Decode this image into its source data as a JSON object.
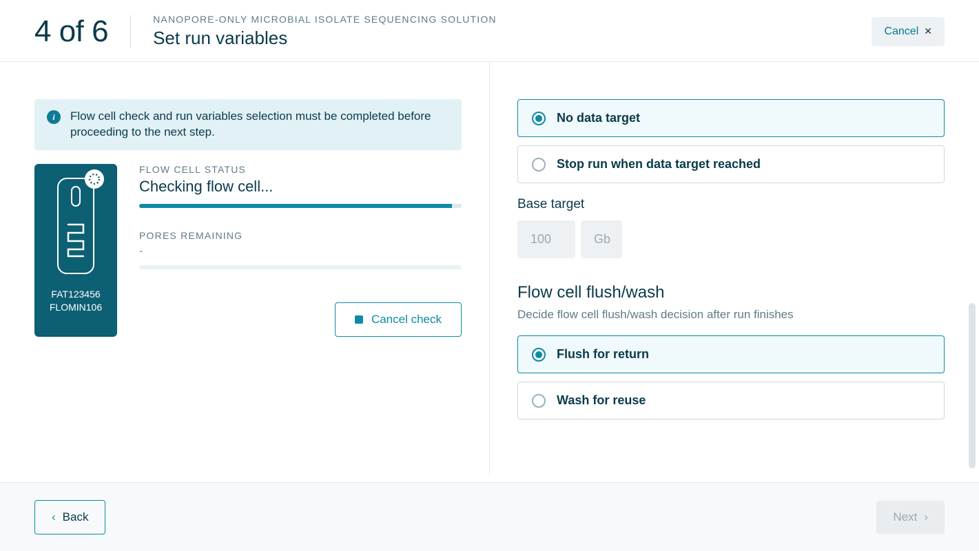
{
  "header": {
    "step_counter": "4 of 6",
    "subtitle": "NANOPORE-ONLY MICROBIAL ISOLATE SEQUENCING SOLUTION",
    "title": "Set run variables",
    "cancel_label": "Cancel"
  },
  "left": {
    "info_text": "Flow cell check and run variables selection must be completed before proceeding to the next step.",
    "flow_card": {
      "line1": "FAT123456",
      "line2": "FLOMIN106"
    },
    "status_label": "FLOW CELL STATUS",
    "status_value": "Checking flow cell...",
    "status_progress_pct": 97,
    "pores_label": "PORES REMAINING",
    "pores_value": "-",
    "cancel_check_label": "Cancel check"
  },
  "right": {
    "data_target": {
      "options": [
        {
          "label": "No data target",
          "selected": true
        },
        {
          "label": "Stop run when data target reached",
          "selected": false
        }
      ],
      "base_target_label": "Base target",
      "base_target_value": "100",
      "base_target_unit": "Gb"
    },
    "flush": {
      "title": "Flow cell flush/wash",
      "desc": "Decide flow cell flush/wash decision after run finishes",
      "options": [
        {
          "label": "Flush for return",
          "selected": true
        },
        {
          "label": "Wash for reuse",
          "selected": false
        }
      ]
    }
  },
  "footer": {
    "back_label": "Back",
    "next_label": "Next"
  }
}
